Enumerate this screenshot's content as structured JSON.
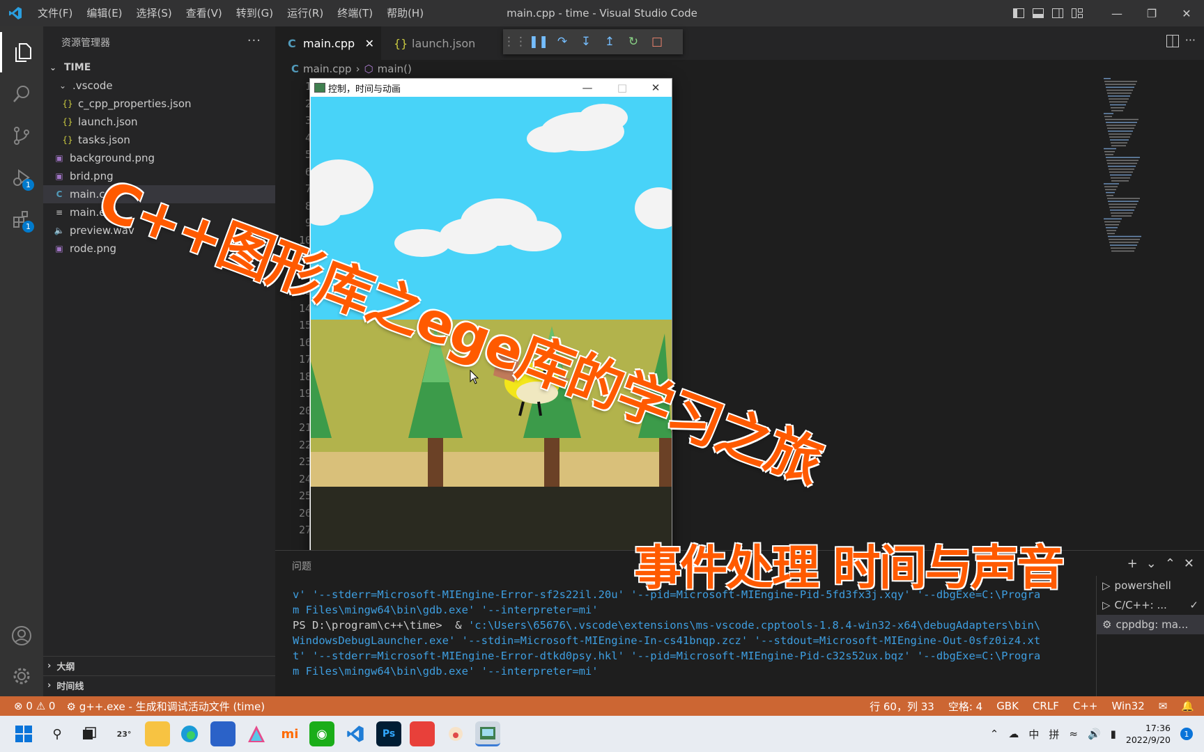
{
  "titlebar": {
    "menu": [
      "文件(F)",
      "编辑(E)",
      "选择(S)",
      "查看(V)",
      "转到(G)",
      "运行(R)",
      "终端(T)",
      "帮助(H)"
    ],
    "window_title": "main.cpp - time - Visual Studio Code"
  },
  "activity": {
    "run_badge": "1",
    "extensions_badge": "1"
  },
  "sidebar": {
    "title": "资源管理器",
    "root": "TIME",
    "items": [
      {
        "label": ".vscode",
        "kind": "folder"
      },
      {
        "label": "c_cpp_properties.json",
        "kind": "json"
      },
      {
        "label": "launch.json",
        "kind": "json"
      },
      {
        "label": "tasks.json",
        "kind": "json"
      },
      {
        "label": "background.png",
        "kind": "image"
      },
      {
        "label": "brid.png",
        "kind": "image"
      },
      {
        "label": "main.cpp",
        "kind": "cpp"
      },
      {
        "label": "main.exe",
        "kind": "exe"
      },
      {
        "label": "preview.wav",
        "kind": "audio"
      },
      {
        "label": "rode.png",
        "kind": "image"
      }
    ],
    "outline": "大纲",
    "timeline": "时间线"
  },
  "editor": {
    "tabs": [
      "main.cpp",
      "launch.json"
    ],
    "breadcrumb": [
      "main.cpp",
      "main()"
    ],
    "line_numbers": [
      "1",
      "2",
      "3",
      "4",
      "5",
      "6",
      "7",
      "8",
      "9",
      "10",
      "11",
      "12",
      "13",
      "14",
      "15",
      "16",
      "17",
      "18",
      "19",
      "20",
      "21",
      "22",
      "23",
      "24",
      "25",
      "26",
      "27"
    ]
  },
  "game_window": {
    "title": "控制，时间与动画"
  },
  "overlay": {
    "title": "C++图形库之ege库的学习之旅",
    "subtitle": "事件处理 时间与声音"
  },
  "panel": {
    "tab_label": "问题",
    "terminal_lines": [
      [
        [
          "c",
          "v' '--stderr=Microsoft-MIEngine-Error-sf2s22il.20u' '--pid=Microsoft-MIEngine-Pid-5fd3fx3j.xqy' '--dbgExe=C:\\Progra"
        ]
      ],
      [
        [
          "c",
          "m Files\\mingw64\\bin\\gdb.exe' '--interpreter=mi'"
        ]
      ],
      [
        [
          "w",
          "PS D:\\program\\c++\\time>  & "
        ],
        [
          "c",
          "'c:\\Users\\65676\\.vscode\\extensions\\ms-vscode.cpptools-1.8.4-win32-x64\\debugAdapters\\bin\\"
        ]
      ],
      [
        [
          "c",
          "WindowsDebugLauncher.exe' '--stdin=Microsoft-MIEngine-In-cs41bnqp.zcz' '--stdout=Microsoft-MIEngine-Out-0sfz0iz4.xt"
        ]
      ],
      [
        [
          "c",
          "t' '--stderr=Microsoft-MIEngine-Error-dtkd0psy.hkl' '--pid=Microsoft-MIEngine-Pid-c32s52ux.bqz' '--dbgExe=C:\\Progra"
        ]
      ],
      [
        [
          "c",
          "m Files\\mingw64\\bin\\gdb.exe' '--interpreter=mi'"
        ]
      ]
    ],
    "terminals": [
      "powershell",
      "C/C++: ...",
      "cppdbg: ma..."
    ]
  },
  "status": {
    "errors": "0",
    "warnings": "0",
    "task": "g++.exe - 生成和调试活动文件 (time)",
    "position": "行 60，列 33",
    "spaces": "空格: 4",
    "encoding": "GBK",
    "eol": "CRLF",
    "language": "C++",
    "platform": "Win32"
  },
  "taskbar": {
    "weather": "23°",
    "ime": "中",
    "ime2": "拼",
    "time": "17:36",
    "date": "2022/9/20",
    "notif": "1"
  },
  "colors": {
    "accent": "#007acc",
    "status_debug": "#cc6633",
    "overlay_orange": "#ff5a00"
  }
}
